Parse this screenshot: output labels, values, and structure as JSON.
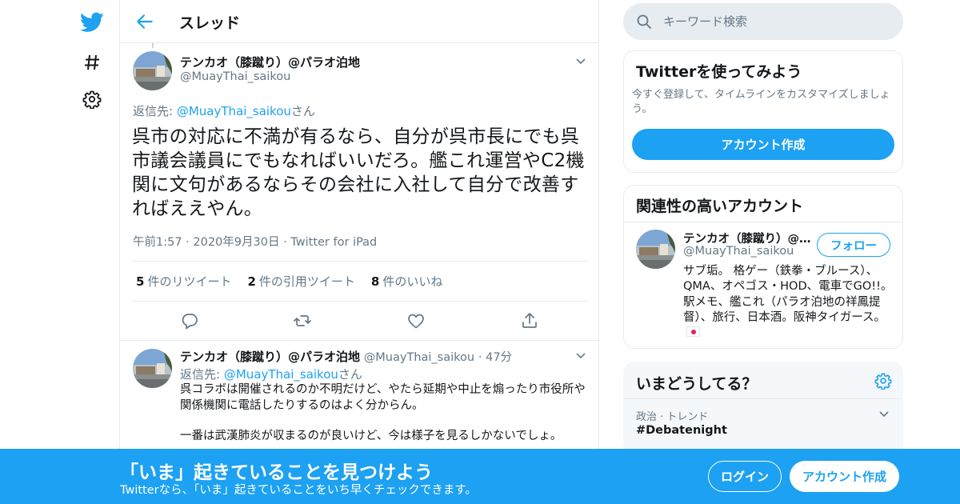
{
  "header": {
    "title": "スレッド"
  },
  "tweet": {
    "author_name": "テンカオ（膝蹴り）@パラオ泊地",
    "author_handle": "@MuayThai_saikou",
    "reply_prefix": "返信先: ",
    "reply_handle": "@MuayThai_saikou",
    "reply_suffix": "さん",
    "text": "呉市の対応に不満が有るなら、自分が呉市長にでも呉市議会議員にでもなればいいだろ。艦これ運営やC2機関に文句があるならその会社に入社して自分で改善すればええやん。",
    "time": "午前1:57",
    "date": "2020年9月30日",
    "source": "Twitter for iPad",
    "retweets_count": "5",
    "retweets_label": "件のリツイート",
    "quotes_count": "2",
    "quotes_label": "件の引用ツイート",
    "likes_count": "8",
    "likes_label": "件のいいね"
  },
  "reply": {
    "author_name": "テンカオ（膝蹴り）@パラオ泊地",
    "author_handle": "@MuayThai_saikou",
    "age": "47分",
    "reply_prefix": "返信先: ",
    "reply_handle": "@MuayThai_saikou",
    "reply_suffix": "さん",
    "paragraph1": "呉コラボは開催されるのか不明だけど、やたら延期や中止を煽ったり市役所や関係機関に電話したりするのはよく分からん。",
    "paragraph2": "一番は武漢肺炎が収まるのが良いけど、今は様子を見るしかないでしょ。"
  },
  "search": {
    "placeholder": "キーワード検索"
  },
  "signup_card": {
    "title": "Twitterを使ってみよう",
    "text": "今すぐ登録して、タイムラインをカスタマイズしましょう。",
    "button": "アカウント作成"
  },
  "related_card": {
    "title": "関連性の高いアカウント",
    "name": "テンカオ（膝蹴り）@パラオ泊地",
    "handle": "@MuayThai_saikou",
    "follow_button": "フォロー",
    "bio": "サブ垢。 格ゲー（鉄拳・ブルース）、QMA、オペゴス・HOD、電車でGO!!。 駅メモ、艦これ（パラオ泊地の祥鳳提督）、旅行、日本酒。阪神タイガース。"
  },
  "trends_card": {
    "title": "いまどうしてる？",
    "category": "政治 · トレンド",
    "trend": "#Debatenight"
  },
  "bottom_bar": {
    "title": "「いま」起きていることを見つけよう",
    "subtitle": "Twitterなら、「いま」起きていることをいち早くチェックできます。",
    "login": "ログイン",
    "signup": "アカウント作成"
  },
  "colors": {
    "accent": "#1da1f2",
    "text": "#14171a",
    "secondary": "#657786",
    "border": "#e6ecf0"
  },
  "icons": [
    "twitter-bird-icon",
    "hashtag-icon",
    "gear-icon",
    "back-arrow-icon",
    "search-icon",
    "chevron-down-icon",
    "reply-icon",
    "retweet-icon",
    "like-icon",
    "share-icon",
    "japan-flag-icon"
  ]
}
